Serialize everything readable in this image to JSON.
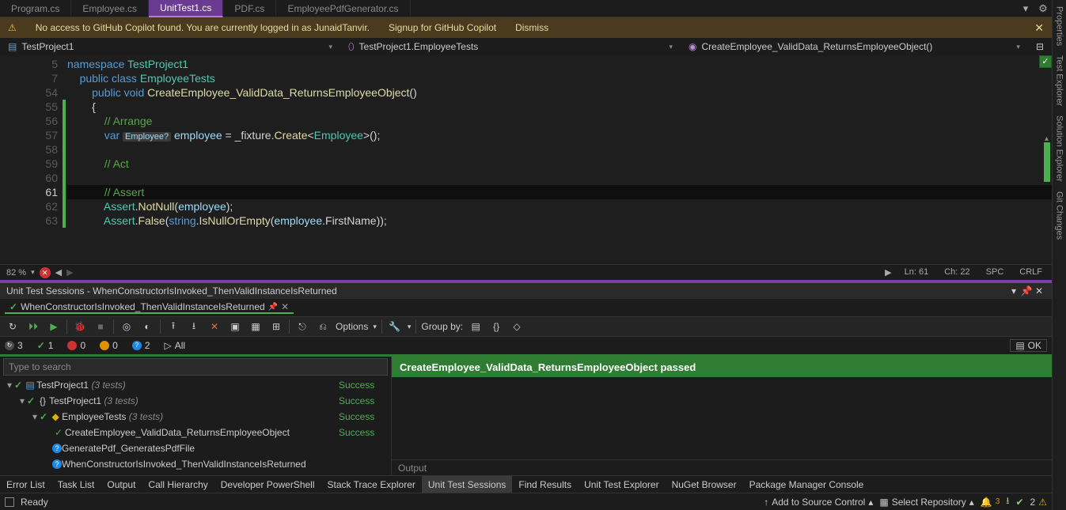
{
  "tabs": {
    "items": [
      "Program.cs",
      "Employee.cs",
      "UnitTest1.cs",
      "PDF.cs",
      "EmployeePdfGenerator.cs"
    ],
    "active": 2
  },
  "copilot": {
    "msg": "No access to GitHub Copilot found. You are currently logged in as JunaidTanvir.",
    "signup": "Signup for GitHub Copilot",
    "dismiss": "Dismiss"
  },
  "nav": {
    "project": "TestProject1",
    "class": "TestProject1.EmployeeTests",
    "method": "CreateEmployee_ValidData_ReturnsEmployeeObject()"
  },
  "code": {
    "lines": [
      {
        "n": 5,
        "tokens": [
          {
            "t": "namespace ",
            "c": "kw"
          },
          {
            "t": "TestProject1",
            "c": "cls"
          }
        ]
      },
      {
        "n": 7,
        "tokens": [
          {
            "t": "    ",
            "c": ""
          },
          {
            "t": "public class ",
            "c": "kw"
          },
          {
            "t": "EmployeeTests",
            "c": "cls"
          }
        ]
      },
      {
        "n": 54,
        "tokens": [
          {
            "t": "        ",
            "c": ""
          },
          {
            "t": "public void ",
            "c": "kw"
          },
          {
            "t": "CreateEmployee_ValidData_ReturnsEmployeeObject",
            "c": "mth"
          },
          {
            "t": "()",
            "c": "pun"
          }
        ]
      },
      {
        "n": 55,
        "g": true,
        "tokens": [
          {
            "t": "        {",
            "c": "pun"
          }
        ]
      },
      {
        "n": 56,
        "g": true,
        "tokens": [
          {
            "t": "            ",
            "c": ""
          },
          {
            "t": "// Arrange",
            "c": "cmt"
          }
        ]
      },
      {
        "n": 57,
        "g": true,
        "tokens": [
          {
            "t": "            ",
            "c": ""
          },
          {
            "t": "var ",
            "c": "kw"
          },
          {
            "t": "Employee?",
            "c": "hint"
          },
          {
            "t": " employee",
            "c": "var"
          },
          {
            "t": " = ",
            "c": "pun"
          },
          {
            "t": "_fixture",
            "c": "prm"
          },
          {
            "t": ".",
            "c": "pun"
          },
          {
            "t": "Create",
            "c": "mth"
          },
          {
            "t": "<",
            "c": "pun"
          },
          {
            "t": "Employee",
            "c": "cls"
          },
          {
            "t": ">();",
            "c": "pun"
          }
        ]
      },
      {
        "n": 58,
        "g": true,
        "tokens": [
          {
            "t": " ",
            "c": ""
          }
        ]
      },
      {
        "n": 59,
        "g": true,
        "tokens": [
          {
            "t": "            ",
            "c": ""
          },
          {
            "t": "// Act",
            "c": "cmt"
          }
        ]
      },
      {
        "n": 60,
        "g": true,
        "tokens": [
          {
            "t": " ",
            "c": ""
          }
        ]
      },
      {
        "n": 61,
        "g": true,
        "hl": true,
        "tokens": [
          {
            "t": "            ",
            "c": ""
          },
          {
            "t": "// Assert",
            "c": "cmt"
          }
        ]
      },
      {
        "n": 62,
        "g": true,
        "tokens": [
          {
            "t": "            ",
            "c": ""
          },
          {
            "t": "Assert",
            "c": "cls"
          },
          {
            "t": ".",
            "c": "pun"
          },
          {
            "t": "NotNull",
            "c": "mth"
          },
          {
            "t": "(",
            "c": "pun"
          },
          {
            "t": "employee",
            "c": "var"
          },
          {
            "t": ");",
            "c": "pun"
          }
        ]
      },
      {
        "n": 63,
        "g": true,
        "tokens": [
          {
            "t": "            ",
            "c": ""
          },
          {
            "t": "Assert",
            "c": "cls"
          },
          {
            "t": ".",
            "c": "pun"
          },
          {
            "t": "False",
            "c": "mth"
          },
          {
            "t": "(",
            "c": "pun"
          },
          {
            "t": "string",
            "c": "kw"
          },
          {
            "t": ".",
            "c": "pun"
          },
          {
            "t": "IsNullOrEmpty",
            "c": "mth"
          },
          {
            "t": "(",
            "c": "pun"
          },
          {
            "t": "employee",
            "c": "var"
          },
          {
            "t": ".",
            "c": "pun"
          },
          {
            "t": "FirstName",
            "c": "prm"
          },
          {
            "t": "));",
            "c": "pun"
          }
        ]
      }
    ]
  },
  "edfoot": {
    "zoom": "82 %",
    "ln": "Ln: 61",
    "ch": "Ch: 22",
    "spc": "SPC",
    "crlf": "CRLF"
  },
  "session": {
    "title": "Unit Test Sessions - WhenConstructorIsInvoked_ThenValidInstanceIsReturned",
    "tab": "WhenConstructorIsInvoked_ThenValidInstanceIsReturned",
    "options": "Options",
    "groupby": "Group by:",
    "counts": {
      "total": "3",
      "pass": "1",
      "fail": "0",
      "warn": "0",
      "info": "2",
      "all": "All"
    },
    "ok": "OK",
    "search_ph": "Type to search",
    "result_head": "CreateEmployee_ValidData_ReturnsEmployeeObject passed",
    "output": "Output"
  },
  "tree": [
    {
      "depth": 0,
      "arrow": "▾",
      "icon": "proj",
      "name": "TestProject1",
      "meta": "(3 tests)",
      "status": "Success"
    },
    {
      "depth": 1,
      "arrow": "▾",
      "icon": "ns",
      "name": "TestProject1",
      "meta": "(3 tests)",
      "status": "Success"
    },
    {
      "depth": 2,
      "arrow": "▾",
      "icon": "cls",
      "name": "EmployeeTests",
      "meta": "(3 tests)",
      "status": "Success"
    },
    {
      "depth": 3,
      "arrow": "",
      "icon": "pass",
      "name": "CreateEmployee_ValidData_ReturnsEmployeeObject",
      "meta": "",
      "status": "Success"
    },
    {
      "depth": 3,
      "arrow": "",
      "icon": "info",
      "name": "GeneratePdf_GeneratesPdfFile",
      "meta": "",
      "status": ""
    },
    {
      "depth": 3,
      "arrow": "",
      "icon": "info",
      "name": "WhenConstructorIsInvoked_ThenValidInstanceIsReturned",
      "meta": "",
      "status": ""
    }
  ],
  "btabs": [
    "Error List",
    "Task List",
    "Output",
    "Call Hierarchy",
    "Developer PowerShell",
    "Stack Trace Explorer",
    "Unit Test Sessions",
    "Find Results",
    "Unit Test Explorer",
    "NuGet Browser",
    "Package Manager Console"
  ],
  "btab_active": 6,
  "status": {
    "ready": "Ready",
    "src": "Add to Source Control",
    "repo": "Select Repository",
    "notif": "3",
    "err": "2"
  },
  "sidetabs": [
    "Properties",
    "Test Explorer",
    "Solution Explorer",
    "Git Changes"
  ]
}
